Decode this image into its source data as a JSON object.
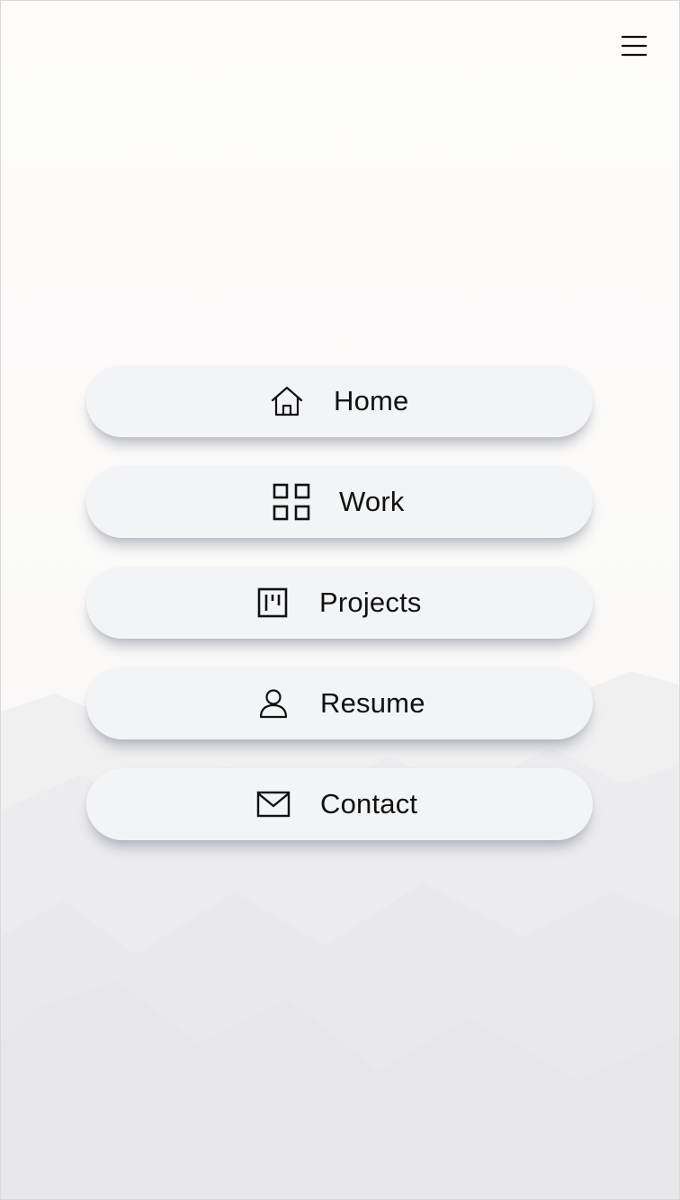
{
  "header": {
    "menu_icon": "hamburger-icon"
  },
  "nav": {
    "items": [
      {
        "label": "Home",
        "icon": "home-icon"
      },
      {
        "label": "Work",
        "icon": "grid-icon"
      },
      {
        "label": "Projects",
        "icon": "board-icon"
      },
      {
        "label": "Resume",
        "icon": "person-icon"
      },
      {
        "label": "Contact",
        "icon": "mail-icon"
      }
    ]
  },
  "colors": {
    "button_bg": "#f3f4f6",
    "text": "#111111",
    "page_bg": "#fdfcfa"
  }
}
